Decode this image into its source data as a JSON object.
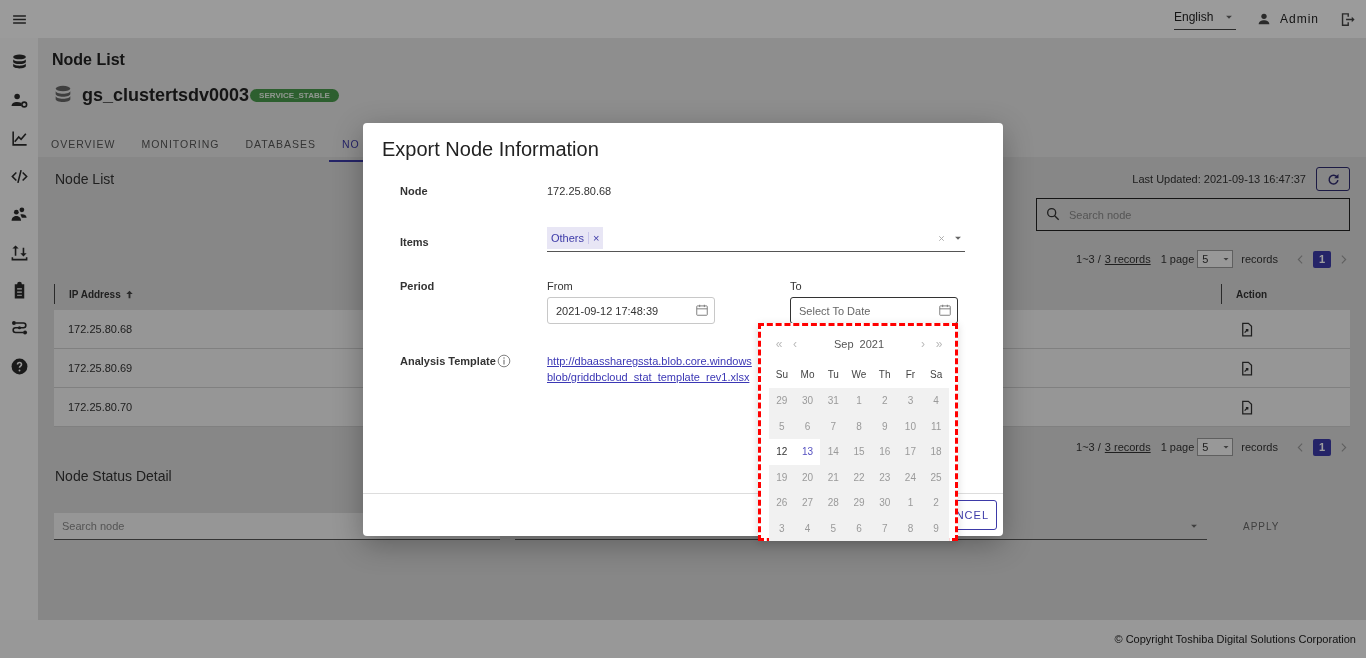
{
  "topbar": {
    "language": "English",
    "user": "Admin"
  },
  "header": {
    "title": "Node List",
    "cluster_name": "gs_clustertsdv0003",
    "status": "SERVICE_STABLE"
  },
  "tabs": [
    {
      "label": "OVERVIEW",
      "selected": false
    },
    {
      "label": "MONITORING",
      "selected": false
    },
    {
      "label": "DATABASES",
      "selected": false
    },
    {
      "label": "NO",
      "selected": true
    }
  ],
  "node_list": {
    "title": "Node List",
    "last_updated": "Last Updated: 2021-09-13 16:47:37",
    "search": {
      "placeholder": "Search node"
    },
    "pagination_top": {
      "range": "1~3 /",
      "records_link": "3 records",
      "page_label": "1 page",
      "page_size": "5",
      "records_label": "records",
      "pages": [
        {
          "label": "1",
          "selected": true
        }
      ]
    },
    "columns": [
      {
        "label": "IP Address",
        "sorted": true
      },
      {
        "label": "Action",
        "sorted": false
      }
    ],
    "rows": [
      {
        "ip": "172.25.80.68"
      },
      {
        "ip": "172.25.80.69"
      },
      {
        "ip": "172.25.80.70"
      }
    ],
    "pagination_bottom": {
      "range": "1~3 /",
      "records_link": "3 records",
      "page_label": "1 page",
      "page_size": "5",
      "records_label": "records",
      "pages": [
        {
          "label": "1",
          "selected": true
        }
      ]
    }
  },
  "node_status_detail": {
    "title": "Node Status Detail",
    "search": {
      "placeholder": "Search node"
    },
    "apply": "APPLY"
  },
  "footer": "© Copyright Toshiba Digital Solutions Corporation",
  "dialog": {
    "title": "Export Node Information",
    "fields": [
      {
        "kind": "text",
        "label": "Node",
        "value": "172.25.80.68"
      },
      {
        "kind": "tags",
        "label": "Items",
        "tags": [
          {
            "label": "Others",
            "remove": "×"
          }
        ]
      },
      {
        "kind": "period",
        "label": "Period",
        "from": {
          "label": "From",
          "value": "2021-09-12 17:48:39",
          "focused": false
        },
        "to": {
          "label": "To",
          "placeholder": "Select To Date",
          "focused": true
        }
      },
      {
        "kind": "link",
        "label": "Analysis Template",
        "info": true,
        "link": "http://dbaassharegssta.blob.core.windows blob/griddbcloud_stat_template_rev1.xlsx"
      }
    ],
    "cancel": "NCEL"
  },
  "calendar": {
    "outlined": true,
    "prev_year": "«",
    "prev_month": "‹",
    "month": "Sep",
    "year": "2021",
    "next_month": "›",
    "next_year": "»",
    "weekdays": [
      "Su",
      "Mo",
      "Tu",
      "We",
      "Th",
      "Fr",
      "Sa"
    ],
    "weeks": [
      [
        {
          "d": "29",
          "disabled": true,
          "today": false
        },
        {
          "d": "30",
          "disabled": true,
          "today": false
        },
        {
          "d": "31",
          "disabled": true,
          "today": false
        },
        {
          "d": "1",
          "disabled": true,
          "today": false
        },
        {
          "d": "2",
          "disabled": true,
          "today": false
        },
        {
          "d": "3",
          "disabled": true,
          "today": false
        },
        {
          "d": "4",
          "disabled": true,
          "today": false
        }
      ],
      [
        {
          "d": "5",
          "disabled": true,
          "today": false
        },
        {
          "d": "6",
          "disabled": true,
          "today": false
        },
        {
          "d": "7",
          "disabled": true,
          "today": false
        },
        {
          "d": "8",
          "disabled": true,
          "today": false
        },
        {
          "d": "9",
          "disabled": true,
          "today": false
        },
        {
          "d": "10",
          "disabled": true,
          "today": false
        },
        {
          "d": "11",
          "disabled": true,
          "today": false
        }
      ],
      [
        {
          "d": "12",
          "disabled": false,
          "today": false
        },
        {
          "d": "13",
          "disabled": false,
          "today": true
        },
        {
          "d": "14",
          "disabled": true,
          "today": false
        },
        {
          "d": "15",
          "disabled": true,
          "today": false
        },
        {
          "d": "16",
          "disabled": true,
          "today": false
        },
        {
          "d": "17",
          "disabled": true,
          "today": false
        },
        {
          "d": "18",
          "disabled": true,
          "today": false
        }
      ],
      [
        {
          "d": "19",
          "disabled": true,
          "today": false
        },
        {
          "d": "20",
          "disabled": true,
          "today": false
        },
        {
          "d": "21",
          "disabled": true,
          "today": false
        },
        {
          "d": "22",
          "disabled": true,
          "today": false
        },
        {
          "d": "23",
          "disabled": true,
          "today": false
        },
        {
          "d": "24",
          "disabled": true,
          "today": false
        },
        {
          "d": "25",
          "disabled": true,
          "today": false
        }
      ],
      [
        {
          "d": "26",
          "disabled": true,
          "today": false
        },
        {
          "d": "27",
          "disabled": true,
          "today": false
        },
        {
          "d": "28",
          "disabled": true,
          "today": false
        },
        {
          "d": "29",
          "disabled": true,
          "today": false
        },
        {
          "d": "30",
          "disabled": true,
          "today": false
        },
        {
          "d": "1",
          "disabled": true,
          "today": false
        },
        {
          "d": "2",
          "disabled": true,
          "today": false
        }
      ],
      [
        {
          "d": "3",
          "disabled": true,
          "today": false
        },
        {
          "d": "4",
          "disabled": true,
          "today": false
        },
        {
          "d": "5",
          "disabled": true,
          "today": false
        },
        {
          "d": "6",
          "disabled": true,
          "today": false
        },
        {
          "d": "7",
          "disabled": true,
          "today": false
        },
        {
          "d": "8",
          "disabled": true,
          "today": false
        },
        {
          "d": "9",
          "disabled": true,
          "today": false
        }
      ]
    ]
  }
}
